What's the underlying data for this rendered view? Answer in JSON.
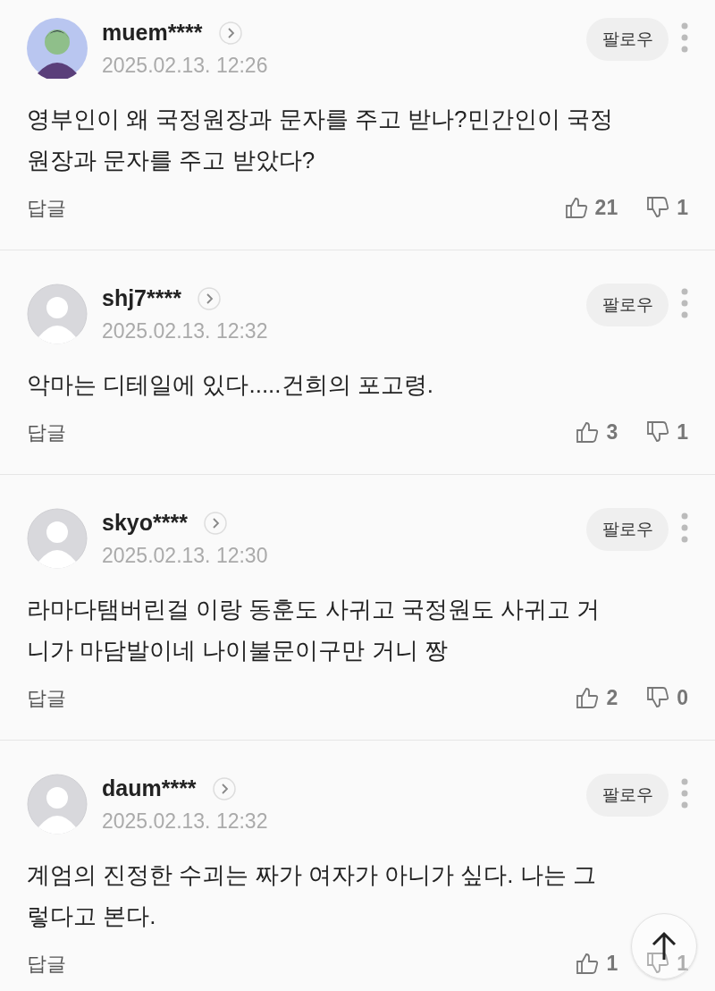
{
  "comments": [
    {
      "kind": "custom_avatar",
      "username": "muem****",
      "date": "2025.02.13. 12:26",
      "follow": "팔로우",
      "text": "영부인이 왜 국정원장과 문자를 주고 받나?민간인이 국정원장과 문자를 주고 받았다?",
      "reply": "답글",
      "likes": "21",
      "dislikes": "1"
    },
    {
      "kind": "default_avatar",
      "username": "shj7****",
      "date": "2025.02.13. 12:32",
      "follow": "팔로우",
      "text": "악마는 디테일에 있다.....건희의 포고령.",
      "reply": "답글",
      "likes": "3",
      "dislikes": "1"
    },
    {
      "kind": "default_avatar",
      "username": "skyo****",
      "date": "2025.02.13. 12:30",
      "follow": "팔로우",
      "text": "라마다탬버린걸 이랑 동훈도 사귀고 국정원도 사귀고 거니가 마담발이네 나이불문이구만 거니 짱",
      "reply": "답글",
      "likes": "2",
      "dislikes": "0"
    },
    {
      "kind": "default_avatar",
      "username": "daum****",
      "date": "2025.02.13. 12:32",
      "follow": "팔로우",
      "text": "계엄의 진정한 수괴는 짜가 여자가 아니가 싶다. 나는 그렇다고 본다.",
      "reply": "답글",
      "likes": "1",
      "dislikes": "1"
    }
  ]
}
